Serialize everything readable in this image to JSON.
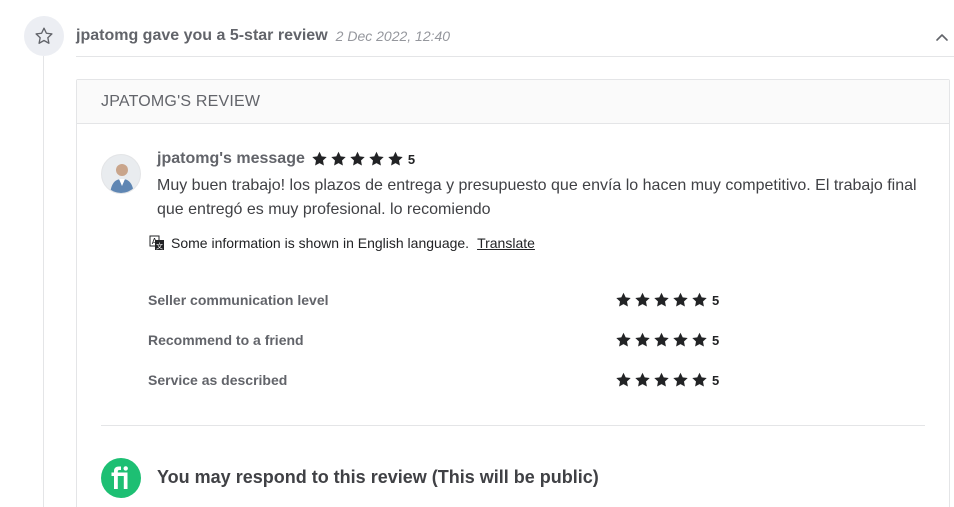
{
  "event": {
    "icon": "star-outline-icon",
    "title": "jpatomg gave you a 5-star review",
    "timestamp": "2 Dec 2022, 12:40",
    "collapse_icon": "chevron-up-icon"
  },
  "review": {
    "header": "JPATOMG'S REVIEW",
    "author_label": "jpatomg's message",
    "rating": "5",
    "stars_count": 5,
    "message": "Muy buen trabajo! los plazos de entrega y presupuesto que envía lo hacen muy competitivo. El trabajo final que entregó es muy profesional. lo recomiendo",
    "translate_notice": "Some information is shown in English language.",
    "translate_link": "Translate",
    "breakdown": [
      {
        "label": "Seller communication level",
        "rating": "5",
        "stars": 5
      },
      {
        "label": "Recommend to a friend",
        "rating": "5",
        "stars": 5
      },
      {
        "label": "Service as described",
        "rating": "5",
        "stars": 5
      }
    ]
  },
  "respond": {
    "title": "You may respond to this review (This will be public)",
    "logo_icon": "fiverr-logo-icon"
  },
  "colors": {
    "brand": "#1dbf73",
    "text_dark": "#404145",
    "text_muted": "#62646a",
    "border": "#e4e5e7"
  }
}
